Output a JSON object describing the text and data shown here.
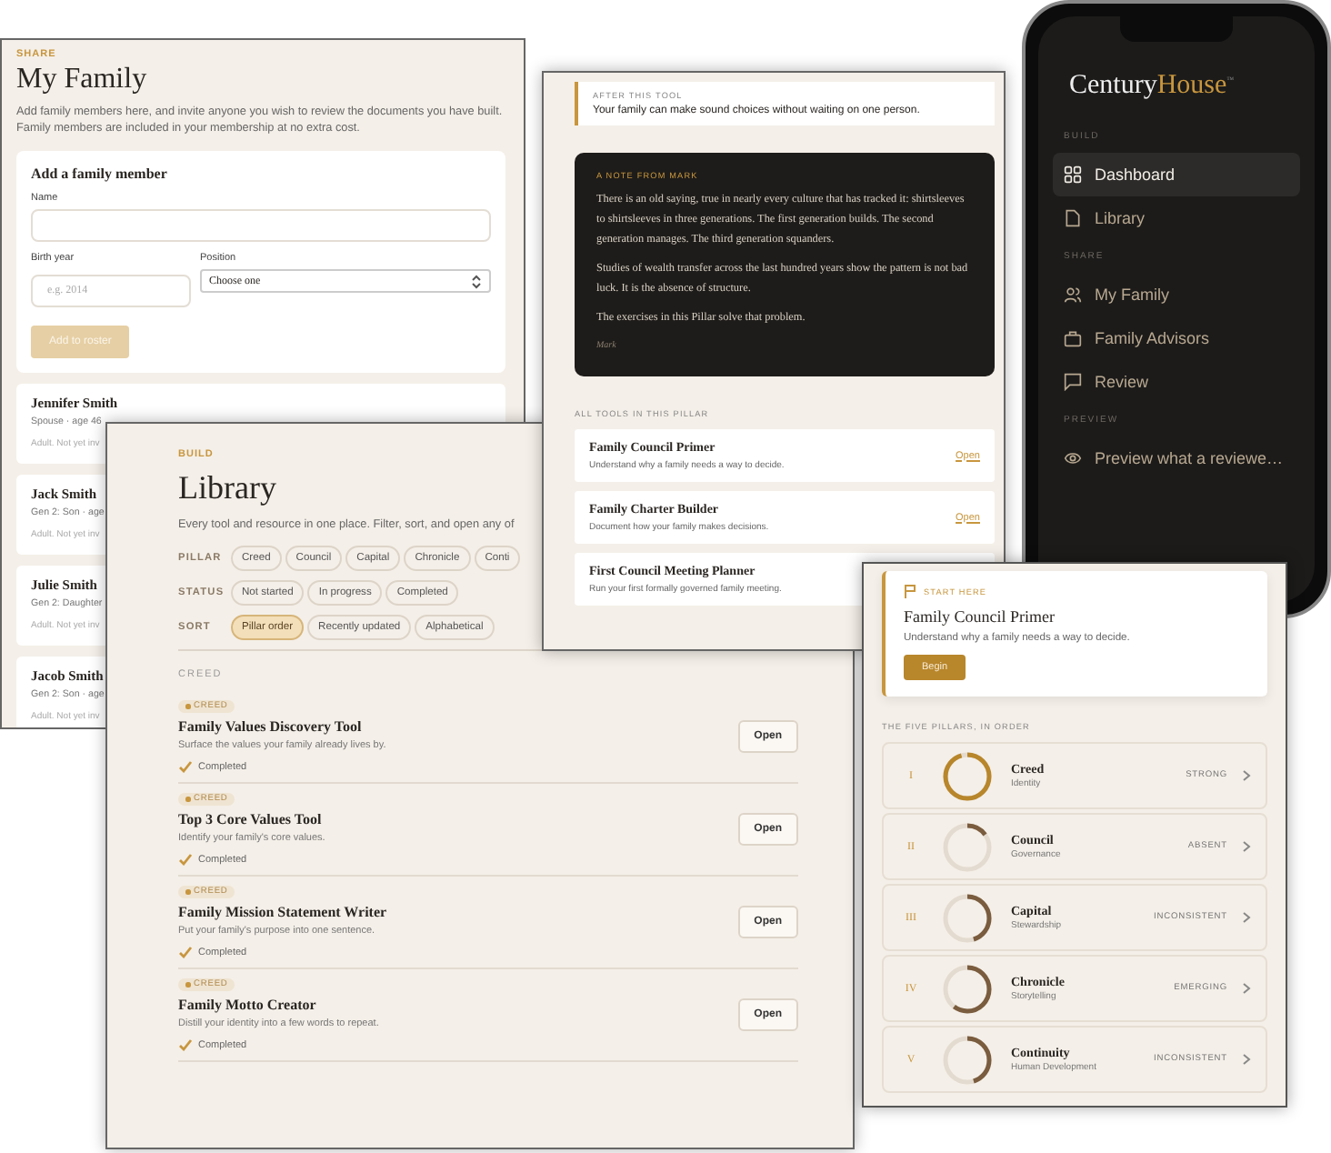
{
  "my_family": {
    "eyebrow": "SHARE",
    "title": "My Family",
    "description": "Add family members here, and invite anyone you wish to review the documents you have built. Family members are included in your membership at no extra cost.",
    "form": {
      "title": "Add a family member",
      "name_label": "Name",
      "birth_label": "Birth year",
      "birth_placeholder": "e.g. 2014",
      "position_label": "Position",
      "position_value": "Choose one",
      "submit": "Add to roster",
      "submit_disabled": true
    },
    "members": [
      {
        "name": "Jennifer Smith",
        "detail": "Spouse · age 46",
        "status": "Adult. Not yet inv"
      },
      {
        "name": "Jack Smith",
        "detail": "Gen 2: Son · age",
        "status": "Adult. Not yet inv"
      },
      {
        "name": "Julie Smith",
        "detail": "Gen 2: Daughter",
        "status": "Adult. Not yet inv"
      },
      {
        "name": "Jacob Smith",
        "detail": "Gen 2: Son · age",
        "status": "Adult. Not yet inv"
      }
    ]
  },
  "library": {
    "eyebrow": "BUILD",
    "title": "Library",
    "description": "Every tool and resource in one place. Filter, sort, and open any of",
    "filters": [
      {
        "label": "PILLAR",
        "chips": [
          {
            "label": "Creed",
            "selected": false
          },
          {
            "label": "Council",
            "selected": false
          },
          {
            "label": "Capital",
            "selected": false
          },
          {
            "label": "Chronicle",
            "selected": false
          },
          {
            "label": "Conti",
            "selected": false
          }
        ]
      },
      {
        "label": "STATUS",
        "chips": [
          {
            "label": "Not started",
            "selected": false
          },
          {
            "label": "In progress",
            "selected": false
          },
          {
            "label": "Completed",
            "selected": false
          }
        ]
      },
      {
        "label": "SORT",
        "chips": [
          {
            "label": "Pillar order",
            "selected": true
          },
          {
            "label": "Recently updated",
            "selected": false
          },
          {
            "label": "Alphabetical",
            "selected": false
          }
        ]
      }
    ],
    "section": "CREED",
    "items": [
      {
        "tag": "CREED",
        "title": "Family Values Discovery Tool",
        "description": "Surface the values your family already lives by.",
        "status": "Completed",
        "completed": true,
        "action": "Open"
      },
      {
        "tag": "CREED",
        "title": "Top 3 Core Values Tool",
        "description": "Identify your family's core values.",
        "status": "Completed",
        "completed": true,
        "action": "Open"
      },
      {
        "tag": "CREED",
        "title": "Family Mission Statement Writer",
        "description": "Put your family's purpose into one sentence.",
        "status": "Completed",
        "completed": true,
        "action": "Open"
      },
      {
        "tag": "CREED",
        "title": "Family Motto Creator",
        "description": "Distill your identity into a few words to repeat.",
        "status": "Completed",
        "completed": true,
        "action": "Open"
      }
    ]
  },
  "tool_page": {
    "after": {
      "label": "AFTER THIS TOOL",
      "text": "Your family can make sound choices without waiting on one person."
    },
    "note": {
      "label": "A NOTE FROM MARK",
      "paragraphs": [
        "There is an old saying, true in nearly every culture that has tracked it: shirtsleeves to shirtsleeves in three generations. The first generation builds. The second generation manages. The third generation squanders.",
        "Studies of wealth transfer across the last hundred years show the pattern is not bad luck. It is the absence of structure.",
        "The exercises in this Pillar solve that problem."
      ],
      "signature": "Mark"
    },
    "tools_label": "ALL TOOLS IN THIS PILLAR",
    "tools": [
      {
        "title": "Family Council Primer",
        "description": "Understand why a family needs a way to decide.",
        "action": "Open"
      },
      {
        "title": "Family Charter Builder",
        "description": "Document how your family makes decisions.",
        "action": "Open"
      },
      {
        "title": "First Council Meeting Planner",
        "description": "Run your first formally governed family meeting."
      }
    ]
  },
  "phone": {
    "logo": {
      "first": "Century",
      "second": "House",
      "mark": "™"
    },
    "sections": [
      {
        "label": "BUILD",
        "items": [
          {
            "label": "Dashboard",
            "selected": true
          },
          {
            "label": "Library",
            "selected": false
          }
        ]
      },
      {
        "label": "SHARE",
        "items": [
          {
            "label": "My Family",
            "selected": false
          },
          {
            "label": "Family Advisors",
            "selected": false
          },
          {
            "label": "Review",
            "selected": false
          }
        ]
      },
      {
        "label": "PREVIEW",
        "items": [
          {
            "label": "Preview what a reviewe…",
            "selected": false
          }
        ]
      }
    ]
  },
  "dashboard": {
    "start": {
      "label": "START HERE",
      "title": "Family Council Primer",
      "description": "Understand why a family needs a way to decide.",
      "action": "Begin"
    },
    "pillars_label": "THE FIVE PILLARS, IN ORDER",
    "pillars": [
      {
        "numeral": "I",
        "name": "Creed",
        "subtitle": "Identity",
        "status": "STRONG",
        "level": 0.95,
        "color": "#b8862b"
      },
      {
        "numeral": "II",
        "name": "Council",
        "subtitle": "Governance",
        "status": "ABSENT",
        "level": 0.15,
        "color": "#7a5c3e"
      },
      {
        "numeral": "III",
        "name": "Capital",
        "subtitle": "Stewardship",
        "status": "INCONSISTENT",
        "level": 0.45,
        "color": "#7a5c3e"
      },
      {
        "numeral": "IV",
        "name": "Chronicle",
        "subtitle": "Storytelling",
        "status": "EMERGING",
        "level": 0.6,
        "color": "#7a5c3e"
      },
      {
        "numeral": "V",
        "name": "Continuity",
        "subtitle": "Human Development",
        "status": "INCONSISTENT",
        "level": 0.45,
        "color": "#7a5c3e"
      }
    ]
  }
}
